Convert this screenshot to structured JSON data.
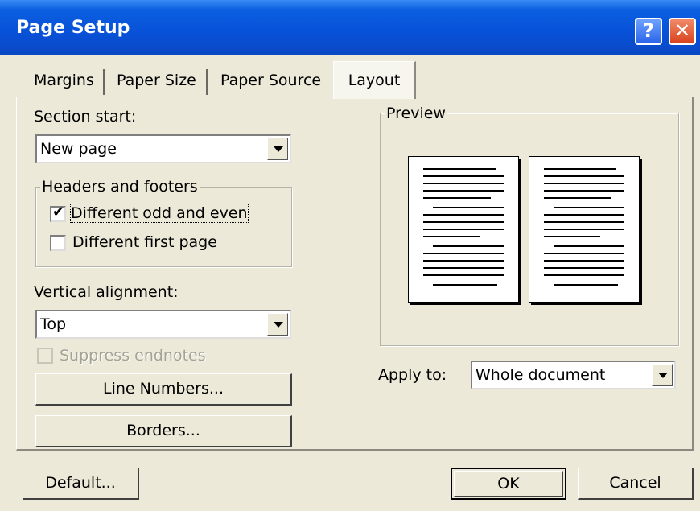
{
  "window": {
    "title": "Page Setup",
    "help_label": "?",
    "close_label": "✕"
  },
  "tabs": [
    {
      "label": "Margins",
      "active": false
    },
    {
      "label": "Paper Size",
      "active": false
    },
    {
      "label": "Paper Source",
      "active": false
    },
    {
      "label": "Layout",
      "active": true
    }
  ],
  "section_start": {
    "label": "Section start:",
    "value": "New page"
  },
  "headers_footers": {
    "title": "Headers and footers",
    "different_odd_even": {
      "label": "Different odd and even",
      "checked": true
    },
    "different_first_page": {
      "label": "Different first page",
      "checked": false
    }
  },
  "vertical_alignment": {
    "label": "Vertical alignment:",
    "value": "Top"
  },
  "suppress_endnotes": {
    "label": "Suppress endnotes",
    "checked": false,
    "disabled": true
  },
  "buttons": {
    "line_numbers": "Line Numbers...",
    "borders": "Borders...",
    "default": "Default...",
    "ok": "OK",
    "cancel": "Cancel"
  },
  "preview": {
    "title": "Preview"
  },
  "apply_to": {
    "label": "Apply to:",
    "value": "Whole document"
  },
  "icons": {
    "check": "✔"
  }
}
